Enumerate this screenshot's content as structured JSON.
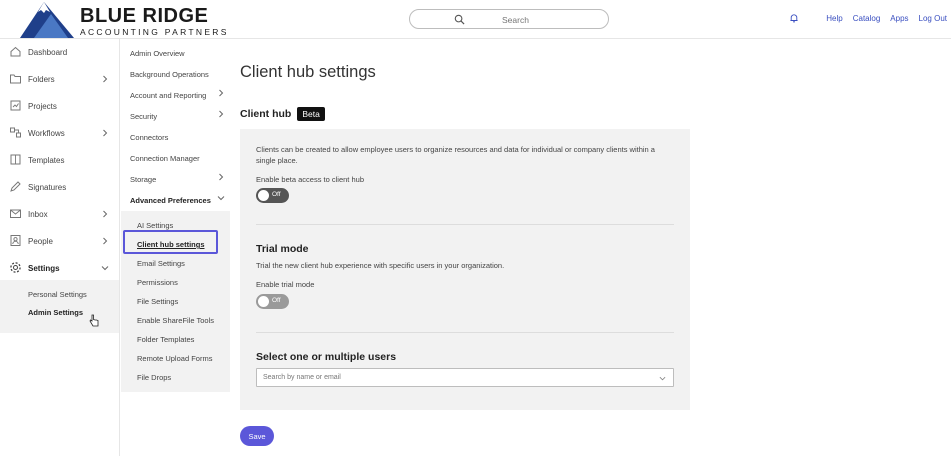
{
  "brand": {
    "title": "BLUE RIDGE",
    "subtitle": "ACCOUNTING PARTNERS"
  },
  "search": {
    "placeholder": "Search"
  },
  "top_links": [
    "Help",
    "Catalog",
    "Apps",
    "Log Out"
  ],
  "left_nav": {
    "items": [
      {
        "label": "Dashboard",
        "icon": "home-icon"
      },
      {
        "label": "Folders",
        "icon": "folder-icon"
      },
      {
        "label": "Projects",
        "icon": "projects-icon"
      },
      {
        "label": "Workflows",
        "icon": "workflow-icon"
      },
      {
        "label": "Templates",
        "icon": "template-icon"
      },
      {
        "label": "Signatures",
        "icon": "signature-icon"
      },
      {
        "label": "Inbox",
        "icon": "inbox-icon"
      },
      {
        "label": "People",
        "icon": "people-icon"
      },
      {
        "label": "Settings",
        "icon": "gear-icon"
      }
    ],
    "settings_sub": [
      "Personal Settings",
      "Admin Settings"
    ]
  },
  "admin_nav": {
    "items": [
      "Admin Overview",
      "Background Operations",
      "Account and Reporting",
      "Security",
      "Connectors",
      "Connection Manager",
      "Storage",
      "Advanced Preferences"
    ],
    "advanced_sub": [
      "AI Settings",
      "Client hub settings",
      "Email Settings",
      "Permissions",
      "File Settings",
      "Enable ShareFile Tools",
      "Folder Templates",
      "Remote Upload Forms",
      "File Drops"
    ]
  },
  "main": {
    "page_title": "Client hub settings",
    "section_title": "Client hub",
    "badge": "Beta",
    "client_hub_desc": "Clients can be created to allow employee users to organize resources and data for individual or company clients within a single place.",
    "beta_toggle_label": "Enable beta access to client hub",
    "beta_toggle_state": "Off",
    "trial_title": "Trial mode",
    "trial_desc": "Trial the new client hub experience with specific users in your organization.",
    "trial_toggle_label": "Enable trial mode",
    "trial_toggle_state": "Off",
    "users_title": "Select one or multiple users",
    "users_placeholder": "Search by name or email",
    "save_label": "Save"
  },
  "colors": {
    "accent": "#5b57d9",
    "brand": "#1f3f8a",
    "toggle_off": "#555555",
    "toggle_off_disabled": "#9a9a9a",
    "link": "#3a4fc0"
  }
}
